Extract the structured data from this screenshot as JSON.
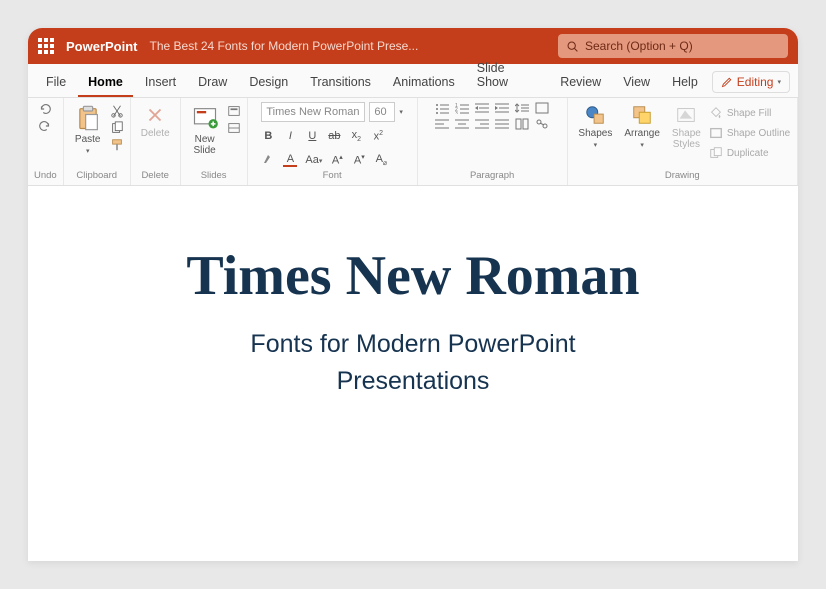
{
  "colors": {
    "brand": "#c43e1c",
    "title_text": "#16334f"
  },
  "titlebar": {
    "app": "PowerPoint",
    "document": "The Best 24 Fonts for Modern PowerPoint Prese..."
  },
  "search": {
    "placeholder": "Search (Option + Q)"
  },
  "tabs": {
    "items": [
      "File",
      "Home",
      "Insert",
      "Draw",
      "Design",
      "Transitions",
      "Animations",
      "Slide Show",
      "Review",
      "View",
      "Help"
    ],
    "active_index": 1,
    "editing_label": "Editing"
  },
  "ribbon": {
    "undo": {
      "label": "Undo"
    },
    "clipboard": {
      "label": "Clipboard",
      "paste": "Paste"
    },
    "delete": {
      "label": "Delete",
      "button": "Delete"
    },
    "slides": {
      "label": "Slides",
      "new_slide": "New\nSlide"
    },
    "font": {
      "label": "Font",
      "name": "Times New Roman",
      "size": "60",
      "bold": "B",
      "italic": "I",
      "underline": "U",
      "strike": "ab",
      "sub": "x",
      "sup": "x"
    },
    "paragraph": {
      "label": "Paragraph"
    },
    "drawing": {
      "label": "Drawing",
      "shapes": "Shapes",
      "arrange": "Arrange",
      "shape_styles": "Shape\nStyles",
      "shape_fill": "Shape Fill",
      "shape_outline": "Shape Outline",
      "duplicate": "Duplicate"
    }
  },
  "slide": {
    "title": "Times New Roman",
    "subtitle_line1": "Fonts for Modern PowerPoint",
    "subtitle_line2": "Presentations"
  }
}
